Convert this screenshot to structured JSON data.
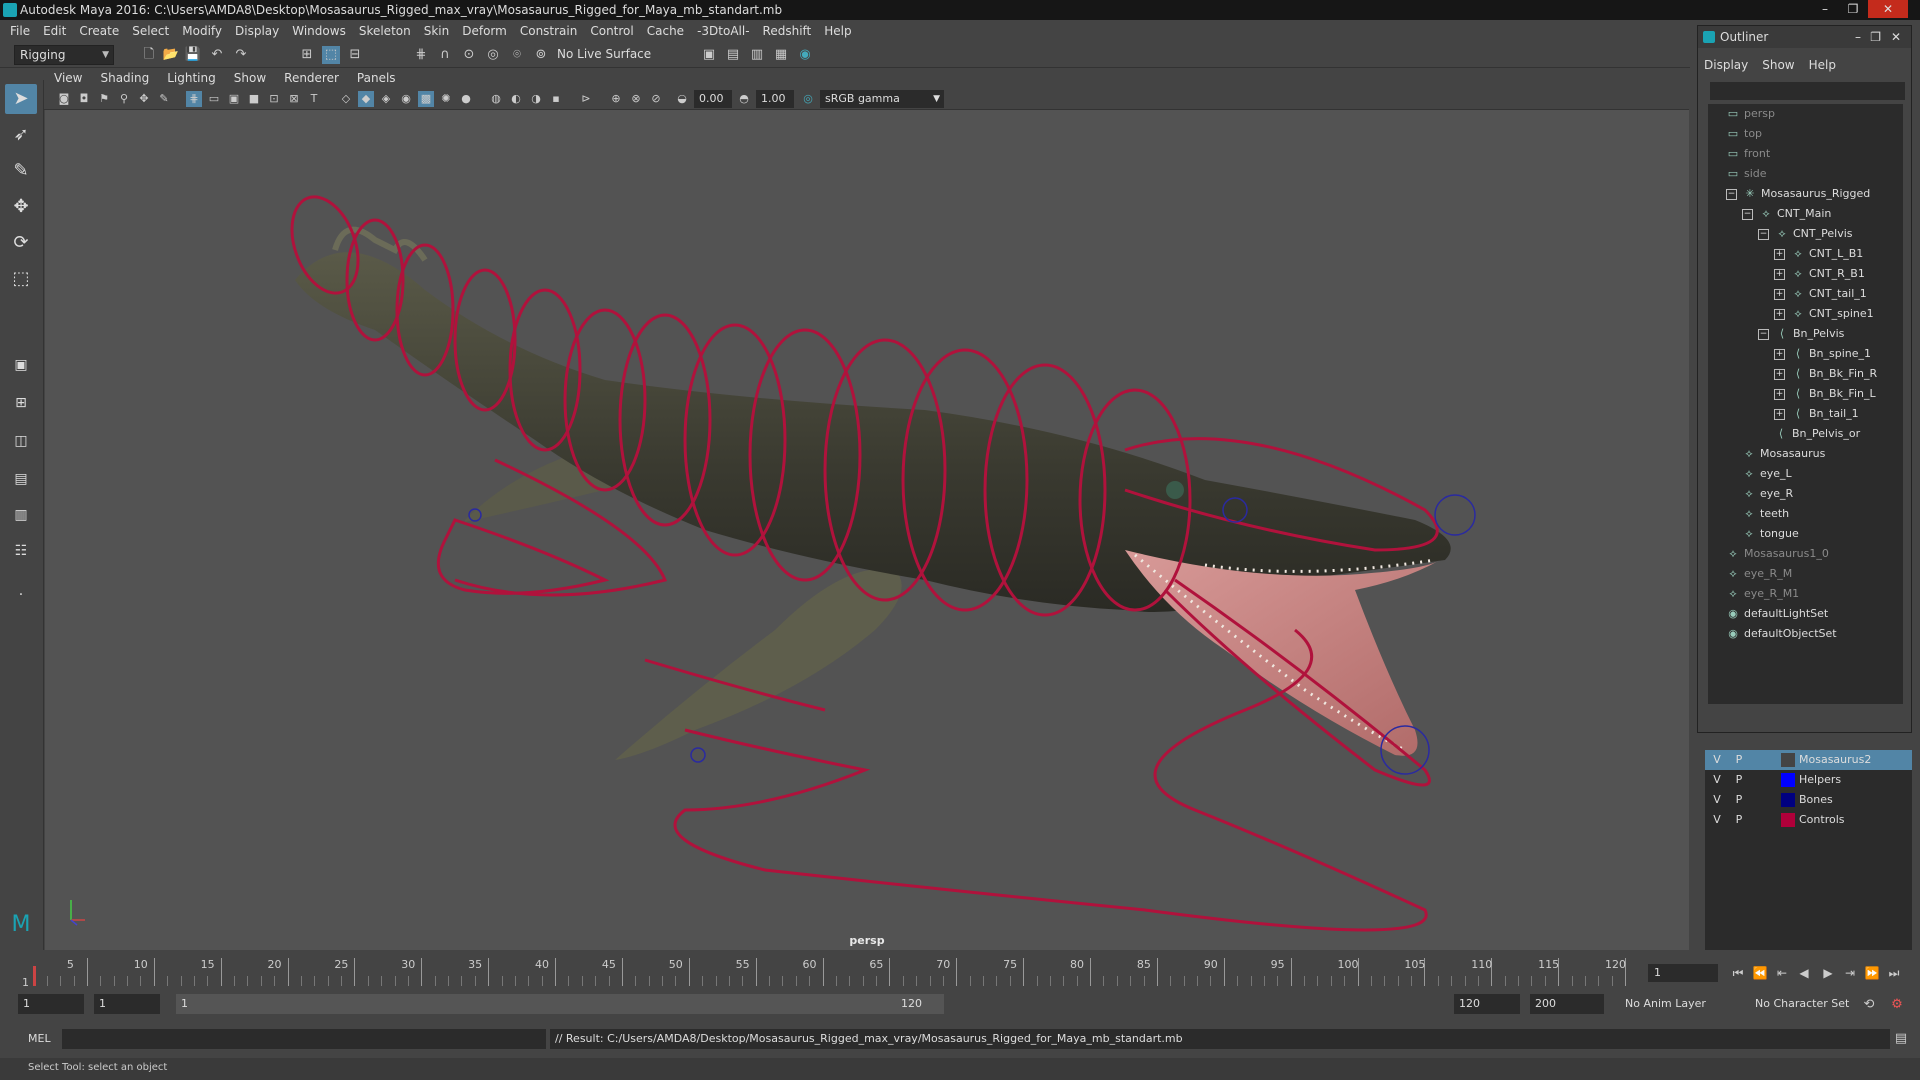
{
  "window": {
    "title": "Autodesk Maya 2016: C:\\Users\\AMDA8\\Desktop\\Mosasaurus_Rigged_max_vray\\Mosasaurus_Rigged_for_Maya_mb_standart.mb"
  },
  "menu": [
    "File",
    "Edit",
    "Create",
    "Select",
    "Modify",
    "Display",
    "Windows",
    "Skeleton",
    "Skin",
    "Deform",
    "Constrain",
    "Control",
    "Cache",
    "-3DtoAll-",
    "Redshift",
    "Help"
  ],
  "statusline": {
    "menuset": "Rigging",
    "live_surface": "No Live Surface"
  },
  "viewport": {
    "menu": [
      "View",
      "Shading",
      "Lighting",
      "Show",
      "Renderer",
      "Panels"
    ],
    "exposure": "0.00",
    "gamma": "1.00",
    "color_space": "sRGB gamma",
    "camera_label": "persp"
  },
  "outliner": {
    "title": "Outliner",
    "menu": [
      "Display",
      "Show",
      "Help"
    ],
    "items": [
      {
        "label": "persp",
        "depth": 0,
        "dim": true,
        "icon": "camera-icon"
      },
      {
        "label": "top",
        "depth": 0,
        "dim": true,
        "icon": "camera-icon"
      },
      {
        "label": "front",
        "depth": 0,
        "dim": true,
        "icon": "camera-icon"
      },
      {
        "label": "side",
        "depth": 0,
        "dim": true,
        "icon": "camera-icon"
      },
      {
        "label": "Mosasaurus_Rigged",
        "depth": 0,
        "dim": false,
        "icon": "joint-root-icon",
        "exp": "−"
      },
      {
        "label": "CNT_Main",
        "depth": 1,
        "dim": false,
        "icon": "control-icon",
        "exp": "−"
      },
      {
        "label": "CNT_Pelvis",
        "depth": 2,
        "dim": false,
        "icon": "control-icon",
        "exp": "−"
      },
      {
        "label": "CNT_L_B1",
        "depth": 3,
        "dim": false,
        "icon": "control-icon",
        "exp": "+"
      },
      {
        "label": "CNT_R_B1",
        "depth": 3,
        "dim": false,
        "icon": "control-icon",
        "exp": "+"
      },
      {
        "label": "CNT_tail_1",
        "depth": 3,
        "dim": false,
        "icon": "control-icon",
        "exp": "+"
      },
      {
        "label": "CNT_spine1",
        "depth": 3,
        "dim": false,
        "icon": "control-icon",
        "exp": "+"
      },
      {
        "label": "Bn_Pelvis",
        "depth": 2,
        "dim": false,
        "icon": "bone-icon",
        "exp": "−"
      },
      {
        "label": "Bn_spine_1",
        "depth": 3,
        "dim": false,
        "icon": "bone-icon",
        "exp": "+"
      },
      {
        "label": "Bn_Bk_Fin_R",
        "depth": 3,
        "dim": false,
        "icon": "bone-icon",
        "exp": "+"
      },
      {
        "label": "Bn_Bk_Fin_L",
        "depth": 3,
        "dim": false,
        "icon": "bone-icon",
        "exp": "+"
      },
      {
        "label": "Bn_tail_1",
        "depth": 3,
        "dim": false,
        "icon": "bone-icon",
        "exp": "+"
      },
      {
        "label": "Bn_Pelvis_or",
        "depth": 3,
        "dim": false,
        "icon": "bone-icon",
        "exp": ""
      },
      {
        "label": "Mosasaurus",
        "depth": 1,
        "dim": false,
        "icon": "mesh-icon",
        "exp": ""
      },
      {
        "label": "eye_L",
        "depth": 1,
        "dim": false,
        "icon": "mesh-icon",
        "exp": ""
      },
      {
        "label": "eye_R",
        "depth": 1,
        "dim": false,
        "icon": "mesh-icon",
        "exp": ""
      },
      {
        "label": "teeth",
        "depth": 1,
        "dim": false,
        "icon": "mesh-icon",
        "exp": ""
      },
      {
        "label": "tongue",
        "depth": 1,
        "dim": false,
        "icon": "mesh-icon",
        "exp": ""
      },
      {
        "label": "Mosasaurus1_0",
        "depth": 0,
        "dim": true,
        "icon": "mesh-icon",
        "exp": ""
      },
      {
        "label": "eye_R_M",
        "depth": 0,
        "dim": true,
        "icon": "mesh-icon",
        "exp": ""
      },
      {
        "label": "eye_R_M1",
        "depth": 0,
        "dim": true,
        "icon": "mesh-icon",
        "exp": ""
      },
      {
        "label": "defaultLightSet",
        "depth": 0,
        "dim": false,
        "icon": "set-icon",
        "exp": ""
      },
      {
        "label": "defaultObjectSet",
        "depth": 0,
        "dim": false,
        "icon": "set-icon",
        "exp": ""
      }
    ]
  },
  "layers": [
    {
      "v": "V",
      "p": "P",
      "name": "Mosasaurus2",
      "color": "#444444",
      "selected": true
    },
    {
      "v": "V",
      "p": "P",
      "name": "Helpers",
      "color": "#0000ff",
      "selected": false
    },
    {
      "v": "V",
      "p": "P",
      "name": "Bones",
      "color": "#000080",
      "selected": false
    },
    {
      "v": "V",
      "p": "P",
      "name": "Controls",
      "color": "#b0003a",
      "selected": false
    }
  ],
  "timeline": {
    "ticks": [
      "5",
      "10",
      "15",
      "20",
      "25",
      "30",
      "35",
      "40",
      "45",
      "50",
      "55",
      "60",
      "65",
      "70",
      "75",
      "80",
      "85",
      "90",
      "95",
      "100",
      "105",
      "110",
      "115",
      "120"
    ],
    "start_marker": "1",
    "current_frame": "1"
  },
  "range": {
    "start": "1",
    "playback_start": "1",
    "slider_start": "1",
    "slider_end": "120",
    "playback_end": "120",
    "end": "200",
    "anim_layer": "No Anim Layer",
    "character_set": "No Character Set"
  },
  "cmdline": {
    "lang": "MEL",
    "result": "// Result: C:/Users/AMDA8/Desktop/Mosasaurus_Rigged_max_vray/Mosasaurus_Rigged_for_Maya_mb_standart.mb"
  },
  "helpline": "Select Tool: select an object",
  "colors": {
    "control_curve": "#b0123c",
    "selection_highlight": "#5285a6"
  }
}
